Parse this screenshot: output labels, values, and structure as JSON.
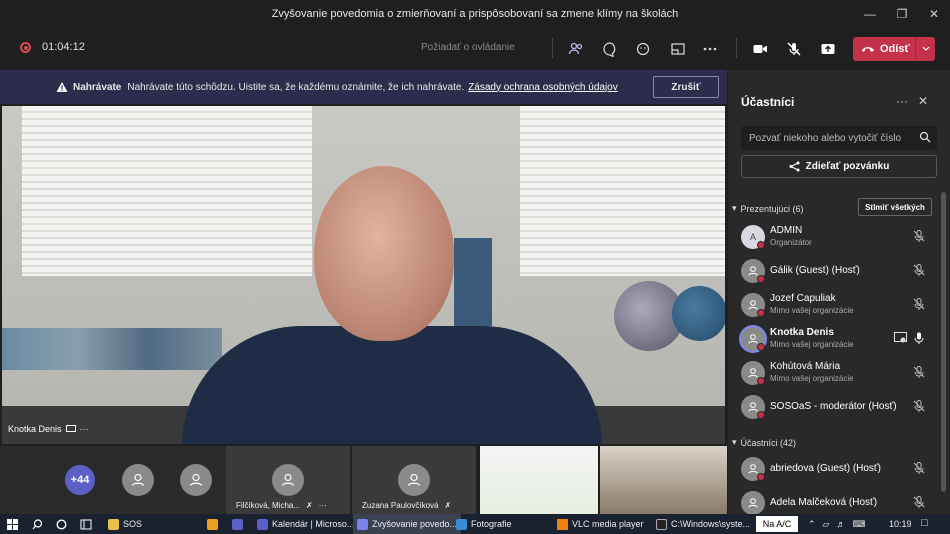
{
  "window": {
    "title": "Zvyšovanie povedomia o zmierňovaní a prispôsobovaní sa zmene klímy na školách"
  },
  "toolbar": {
    "timer": "01:04:12",
    "request_control": "Požiadať o ovládanie",
    "leave_label": "Odísť"
  },
  "recording_banner": {
    "bold": "Nahrávate",
    "text": "Nahrávate túto schôdzu. Uistite sa, že každému oznámite, že ich nahrávate.",
    "link": "Zásady ochrana osobných údajov",
    "stop_label": "Zrušiť"
  },
  "main_video": {
    "speaker_name": "Knotka Denis"
  },
  "strip": {
    "overflow_count": "+44",
    "tiles": [
      {
        "name": "Filčíková, Micha..."
      },
      {
        "name": "Zuzana Paulovčíková"
      }
    ]
  },
  "panel": {
    "title": "Účastníci",
    "invite_placeholder": "Pozvať niekoho alebo vytočiť číslo",
    "share_invite": "Zdieľať pozvánku",
    "presenters_header": "Prezentujúci (6)",
    "mute_all": "Stlmiť všetkých",
    "attendees_header": "Účastníci (42)",
    "presenters": [
      {
        "initial": "A",
        "name": "ADMIN",
        "role": "Organizátor"
      },
      {
        "name": "Gálik (Guest) (Hosť)",
        "role": ""
      },
      {
        "name": "Jozef Capuliak",
        "role": "Mimo vašej organizácie"
      },
      {
        "name": "Knotka Denis",
        "role": "Mimo vašej organizácie"
      },
      {
        "name": "Kohútová Mária",
        "role": "Mimo vašej organizácie"
      },
      {
        "name": "SOSOaS - moderátor (Hosť)",
        "role": ""
      }
    ],
    "attendees": [
      {
        "name": "abriedova (Guest) (Hosť)",
        "role": ""
      },
      {
        "name": "Adela Malčeková (Hosť)",
        "role": ""
      }
    ]
  },
  "taskbar": {
    "items": [
      {
        "label": "SOS"
      },
      {
        "label": "Kalendár | Microso..."
      },
      {
        "label": "Zvyšovanie povedo..."
      },
      {
        "label": "Fotografie"
      },
      {
        "label": "VLC media player"
      },
      {
        "label": "C:\\Windows\\syste..."
      }
    ],
    "keyboard": "Na A/C",
    "clock": "10:19"
  }
}
